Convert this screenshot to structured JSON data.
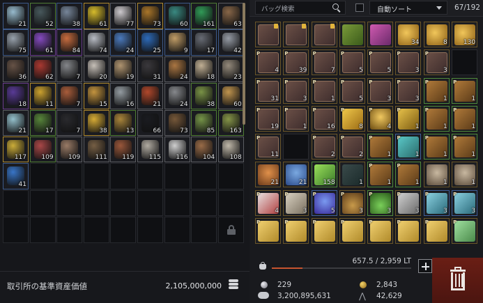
{
  "left_inventory": {
    "items": [
      {
        "name": "keys-icon",
        "qty": "21",
        "c": "#9ec3d6",
        "b": "bl"
      },
      {
        "name": "chain-icon",
        "qty": "52",
        "c": "#4a5b5f",
        "b": "gr"
      },
      {
        "name": "creature-claw-icon",
        "qty": "38",
        "c": "#7b8ba0",
        "b": "bl"
      },
      {
        "name": "gold-nuggets-icon",
        "qty": "61",
        "c": "#e0c42c",
        "b": "go"
      },
      {
        "name": "white-shell-icon",
        "qty": "77",
        "c": "#d6d2d6",
        "b": "wh"
      },
      {
        "name": "treasure-chest-icon",
        "qty": "73",
        "c": "#b07a2a",
        "b": "go"
      },
      {
        "name": "teal-crystal-ore-icon",
        "qty": "60",
        "c": "#3b8f86",
        "b": "bl"
      },
      {
        "name": "green-gem-icon",
        "qty": "161",
        "c": "#32a15a",
        "b": "gr"
      },
      {
        "name": "fabric-roll-icon",
        "qty": "63",
        "c": "#8d6a4a",
        "b": "wh"
      },
      {
        "name": "steel-sword-icon",
        "qty": "75",
        "c": "#9ea8b3",
        "b": "bl"
      },
      {
        "name": "purple-gem-icon",
        "qty": "61",
        "c": "#8a4dc8",
        "b": "pu"
      },
      {
        "name": "crystal-shard-icon",
        "qty": "84",
        "c": "#d07040",
        "b": "pu"
      },
      {
        "name": "dagger-icon",
        "qty": "74",
        "c": "#c0c4cc",
        "b": "wh"
      },
      {
        "name": "crystal-ball-icon",
        "qty": "24",
        "c": "#4d7ec4",
        "b": "bl"
      },
      {
        "name": "cloth-icon",
        "qty": "25",
        "c": "#2e6ec0",
        "b": "bl"
      },
      {
        "name": "parchment-roll-icon",
        "qty": "9",
        "c": "#c9a36a",
        "b": "bl"
      },
      {
        "name": "metal-parts-icon",
        "qty": "17",
        "c": "#6b6f78",
        "b": "bl"
      },
      {
        "name": "gear-icon",
        "qty": "42",
        "c": "#9ba1ab",
        "b": "bl"
      },
      {
        "name": "coat-icon",
        "qty": "36",
        "c": "#6a5548",
        "b": "wh"
      },
      {
        "name": "red-potion-icon",
        "qty": "62",
        "c": "#b03a32",
        "b": "wh"
      },
      {
        "name": "hammer-icon",
        "qty": "7",
        "c": "#8a8c90",
        "b": "wh"
      },
      {
        "name": "teacup-icon",
        "qty": "20",
        "c": "#cfc8c0",
        "b": "wh"
      },
      {
        "name": "shell-cluster-icon",
        "qty": "19",
        "c": "#b79a74",
        "b": "wh"
      },
      {
        "name": "dark-ore-icon",
        "qty": "31",
        "c": "#3c3a3e",
        "b": "wh"
      },
      {
        "name": "wooden-crate-icon",
        "qty": "24",
        "c": "#b27b44",
        "b": "wh"
      },
      {
        "name": "bone-pile-icon",
        "qty": "18",
        "c": "#c9b79a",
        "b": "wh"
      },
      {
        "name": "hourglass-icon",
        "qty": "23",
        "c": "#9a8f80",
        "b": "wh"
      },
      {
        "name": "violet-blade-icon",
        "qty": "18",
        "c": "#5c3c9c",
        "b": "pu"
      },
      {
        "name": "gold-coin-icon",
        "qty": "11",
        "c": "#d4a830",
        "b": "go"
      },
      {
        "name": "feather-icon",
        "qty": "7",
        "c": "#b0603c",
        "b": "wh"
      },
      {
        "name": "small-chest-icon",
        "qty": "15",
        "c": "#cc9a40",
        "b": "go"
      },
      {
        "name": "stone-stack-icon",
        "qty": "16",
        "c": "#9aa2a8",
        "b": "wh"
      },
      {
        "name": "red-coral-icon",
        "qty": "21",
        "c": "#b84a2c",
        "b": "wh"
      },
      {
        "name": "stone-slab-icon",
        "qty": "24",
        "c": "#8c8e92",
        "b": "wh"
      },
      {
        "name": "seedlings-icon",
        "qty": "38",
        "c": "#7e9848",
        "b": "gr"
      },
      {
        "name": "bread-loaf-icon",
        "qty": "60",
        "c": "#c89a50",
        "b": "wh"
      },
      {
        "name": "water-flask-icon",
        "qty": "21",
        "c": "#9ac8d4",
        "b": "wh"
      },
      {
        "name": "green-orb-icon",
        "qty": "17",
        "c": "#5a8a3c",
        "b": "gr"
      },
      {
        "name": "skull-flag-icon",
        "qty": "7",
        "c": "#2a2a2e",
        "b": "wh"
      },
      {
        "name": "gold-coins-icon",
        "qty": "38",
        "c": "#e0b236",
        "b": "go"
      },
      {
        "name": "fish-catch-icon",
        "qty": "13",
        "c": "#b08a3c",
        "b": "gr"
      },
      {
        "name": "empty-slot-a-icon",
        "qty": "66",
        "c": "#1a1b20",
        "b": "wh"
      },
      {
        "name": "soil-heap-icon",
        "qty": "73",
        "c": "#7a5a3a",
        "b": "wh"
      },
      {
        "name": "plant-bulb-icon",
        "qty": "85",
        "c": "#7a9a4a",
        "b": "gr"
      },
      {
        "name": "herb-sack-icon",
        "qty": "163",
        "c": "#8a9a4a",
        "b": "gr"
      },
      {
        "name": "gold-dust-pile-icon",
        "qty": "117",
        "c": "#d4b43a",
        "b": "go"
      },
      {
        "name": "meat-sack-icon",
        "qty": "109",
        "c": "#b04a4a",
        "b": "gr"
      },
      {
        "name": "leather-hide-icon",
        "qty": "109",
        "c": "#a0806a",
        "b": "wh"
      },
      {
        "name": "wood-plank-icon",
        "qty": "111",
        "c": "#7a6246",
        "b": "wh"
      },
      {
        "name": "striped-mat-icon",
        "qty": "119",
        "c": "#a05a3c",
        "b": "wh"
      },
      {
        "name": "bone-fragments-icon",
        "qty": "115",
        "c": "#b8b2a8",
        "b": "wh"
      },
      {
        "name": "white-feather-icon",
        "qty": "116",
        "c": "#d8d8d8",
        "b": "wh"
      },
      {
        "name": "cooked-meat-icon",
        "qty": "104",
        "c": "#a0704a",
        "b": "wh"
      },
      {
        "name": "spine-bone-icon",
        "qty": "108",
        "c": "#c8c0b0",
        "b": "wh"
      },
      {
        "name": "blue-flower-icon",
        "qty": "41",
        "c": "#3a7ad0",
        "b": "bl"
      }
    ],
    "total_slots": 81
  },
  "asset_value": {
    "label": "取引所の基準資産価値",
    "amount": "2,105,000,000"
  },
  "bag": {
    "search_placeholder": "バッグ検索",
    "sort_label": "自動ソート",
    "capacity": "67/192",
    "weight_text": "657.5 / 2,959 LT",
    "weight_fraction": 0.22,
    "items": [
      {
        "k": "box",
        "lock": true
      },
      {
        "k": "box",
        "lock": true
      },
      {
        "k": "box",
        "lock": true
      },
      {
        "k": "green"
      },
      {
        "k": "chest"
      },
      {
        "k": "gold",
        "qty": "34"
      },
      {
        "k": "gold",
        "qty": "8"
      },
      {
        "k": "gold",
        "qty": "130"
      },
      {
        "k": "box",
        "p": true,
        "qty": "4"
      },
      {
        "k": "box",
        "p": true,
        "qty": "39"
      },
      {
        "k": "box",
        "p": true,
        "qty": "7"
      },
      {
        "k": "box",
        "p": true,
        "qty": "5"
      },
      {
        "k": "box",
        "p": true,
        "qty": "5"
      },
      {
        "k": "box",
        "p": true,
        "qty": "3"
      },
      {
        "k": "box",
        "p": true,
        "qty": "3"
      },
      {
        "k": "empty"
      },
      {
        "k": "box",
        "p": true,
        "qty": "31"
      },
      {
        "k": "box",
        "p": true,
        "qty": "3"
      },
      {
        "k": "box",
        "p": true,
        "qty": "1"
      },
      {
        "k": "box",
        "p": true,
        "qty": "5"
      },
      {
        "k": "box",
        "p": true,
        "qty": "3"
      },
      {
        "k": "box",
        "p": true,
        "qty": "3"
      },
      {
        "k": "chest2",
        "p": true,
        "qty": "1"
      },
      {
        "k": "chest2",
        "p": true,
        "qty": "1"
      },
      {
        "k": "box",
        "p": true,
        "qty": "19"
      },
      {
        "k": "box",
        "p": true,
        "qty": "1"
      },
      {
        "k": "box",
        "p": true,
        "qty": "16"
      },
      {
        "k": "card",
        "p": true,
        "qty": "8"
      },
      {
        "k": "lamp",
        "p": true,
        "qty": "4"
      },
      {
        "k": "sword",
        "p": true,
        "qty": "1"
      },
      {
        "k": "chest2",
        "p": true,
        "qty": "1"
      },
      {
        "k": "chest2",
        "p": true,
        "qty": "1"
      },
      {
        "k": "box",
        "p": true,
        "qty": "11"
      },
      {
        "k": "empty"
      },
      {
        "k": "box",
        "p": true,
        "qty": "2"
      },
      {
        "k": "box",
        "p": true,
        "qty": "2"
      },
      {
        "k": "chest2",
        "p": true,
        "qty": "1"
      },
      {
        "k": "teal",
        "p": true,
        "qty": "1"
      },
      {
        "k": "chest2",
        "p": true,
        "qty": "1"
      },
      {
        "k": "chest2",
        "p": true,
        "qty": "1"
      },
      {
        "k": "vase",
        "qty": "21"
      },
      {
        "k": "bluevase",
        "qty": "21"
      },
      {
        "k": "leaf",
        "qty": "158"
      },
      {
        "k": "hat",
        "qty": "1"
      },
      {
        "k": "chest2",
        "p": true,
        "qty": "1"
      },
      {
        "k": "chest2",
        "p": true,
        "qty": "1"
      },
      {
        "k": "urn",
        "qty": "1"
      },
      {
        "k": "urn",
        "qty": "1"
      },
      {
        "k": "cloth",
        "p": true,
        "qty": "4"
      },
      {
        "k": "feather",
        "p": true,
        "qty": "3"
      },
      {
        "k": "bluegem",
        "p": true,
        "qty": "5"
      },
      {
        "k": "flask",
        "p": true,
        "qty": "3"
      },
      {
        "k": "greenflask",
        "p": true,
        "qty": "3"
      },
      {
        "k": "pen",
        "p": true,
        "qty": "3"
      },
      {
        "k": "arrow",
        "p": true,
        "qty": "3"
      },
      {
        "k": "arrow",
        "p": true,
        "qty": "3"
      },
      {
        "k": "ticket",
        "p": true
      },
      {
        "k": "ticket",
        "p": true
      },
      {
        "k": "ticket",
        "p": true
      },
      {
        "k": "ticket",
        "p": true
      },
      {
        "k": "ticket",
        "p": true
      },
      {
        "k": "ticket",
        "p": true
      },
      {
        "k": "ticket",
        "p": true
      },
      {
        "k": "greenticket",
        "p": true
      }
    ]
  },
  "currency": {
    "silver": "229",
    "coins": "3,200,895,631",
    "gold": "2,843",
    "contribution": "42,629"
  },
  "icons": {
    "lock": "lock-icon",
    "search": "search-icon",
    "trash": "trash-icon",
    "add": "plus-icon",
    "weight": "bag-weight-icon"
  }
}
